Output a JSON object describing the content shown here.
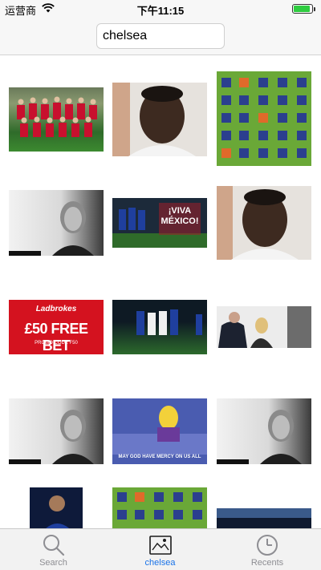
{
  "status_bar": {
    "carrier": "运营商",
    "time": "下午11:15",
    "wifi_icon": "wifi-icon",
    "battery_icon": "battery-icon"
  },
  "search": {
    "query": "chelsea"
  },
  "results": [
    {
      "name": "team-photo-red-kits",
      "style": "team"
    },
    {
      "name": "man-portrait-white-shirt",
      "style": "portrait"
    },
    {
      "name": "player-headshots-grid",
      "style": "headshots"
    },
    {
      "name": "woman-portrait-bw",
      "style": "bw"
    },
    {
      "name": "viva-mexico-players",
      "style": "mexico"
    },
    {
      "name": "man-portrait-white-shirt",
      "style": "portrait"
    },
    {
      "name": "ladbrokes-free-bet-banner",
      "style": "ladbrokes"
    },
    {
      "name": "players-on-pitch-night",
      "style": "pitch"
    },
    {
      "name": "interview-press-conference",
      "style": "press"
    },
    {
      "name": "woman-portrait-bw",
      "style": "bw"
    },
    {
      "name": "cartoon-meme",
      "style": "meme"
    },
    {
      "name": "woman-portrait-bw",
      "style": "bw"
    },
    {
      "name": "player-blue-kit-closeup",
      "style": "player"
    },
    {
      "name": "player-headshots-grid",
      "style": "headshots"
    },
    {
      "name": "stadium-crowd-partial",
      "style": "stadium"
    }
  ],
  "ladbrokes_banner": {
    "brand": "Ladbrokes",
    "offer": "£50 FREE BET",
    "promo": "PROMO CODE F50"
  },
  "mexico_banner": {
    "line1": "¡VIVA",
    "line2": "MÉXICO!"
  },
  "meme_caption": "MAY GOD HAVE MERCY ON US ALL",
  "tab_bar": {
    "tabs": [
      {
        "label": "Search",
        "icon": "search-icon",
        "active": false
      },
      {
        "label": "chelsea",
        "icon": "image-icon",
        "active": true
      },
      {
        "label": "Recents",
        "icon": "clock-icon",
        "active": false
      }
    ]
  },
  "colors": {
    "active_tab": "#1a73e8",
    "inactive_tab": "#8e8e93",
    "battery": "#2ecc40"
  }
}
